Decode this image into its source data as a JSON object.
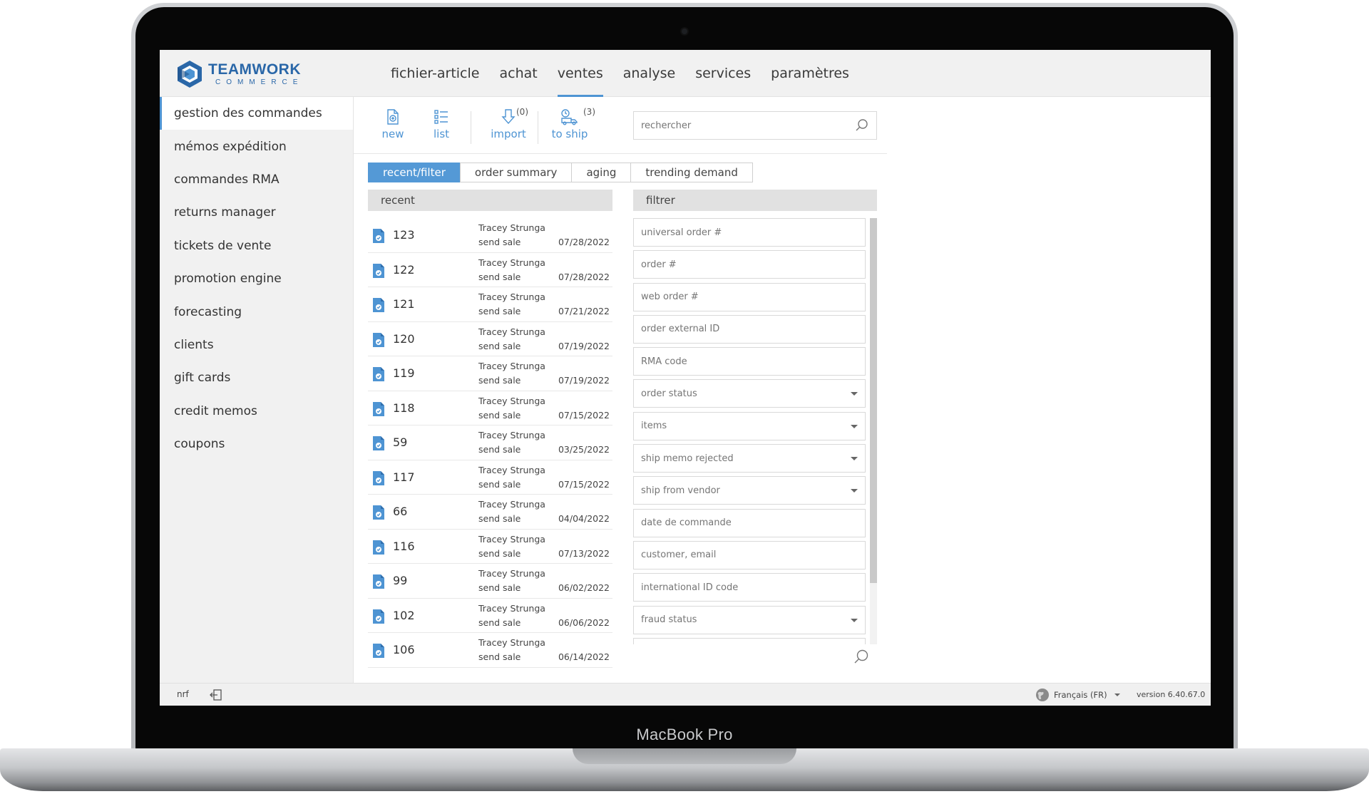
{
  "device": {
    "label": "MacBook Pro"
  },
  "brand": {
    "name": "TEAMWORK",
    "sub": "COMMERCE",
    "color": "#2a67a8"
  },
  "accent": "#4e94d3",
  "top_nav": [
    {
      "label": "fichier-article",
      "active": false
    },
    {
      "label": "achat",
      "active": false
    },
    {
      "label": "ventes",
      "active": true
    },
    {
      "label": "analyse",
      "active": false
    },
    {
      "label": "services",
      "active": false
    },
    {
      "label": "paramètres",
      "active": false
    }
  ],
  "sidebar": {
    "items": [
      {
        "label": "gestion des commandes",
        "active": true
      },
      {
        "label": "mémos expédition"
      },
      {
        "label": "commandes RMA"
      },
      {
        "label": "returns manager"
      },
      {
        "label": "tickets de vente"
      },
      {
        "label": "promotion engine"
      },
      {
        "label": "forecasting"
      },
      {
        "label": "clients"
      },
      {
        "label": "gift cards"
      },
      {
        "label": "credit memos"
      },
      {
        "label": "coupons"
      }
    ]
  },
  "toolbar": {
    "new_label": "new",
    "list_label": "list",
    "import_label": "import",
    "import_count": "(0)",
    "ship_label": "to ship",
    "ship_count": "(3)"
  },
  "search": {
    "placeholder": "rechercher"
  },
  "tabs": [
    {
      "label": "recent/filter",
      "active": true
    },
    {
      "label": "order summary"
    },
    {
      "label": "aging"
    },
    {
      "label": "trending demand"
    }
  ],
  "recent": {
    "header": "recent",
    "rows": [
      {
        "order": "123",
        "customer": "Tracey Strunga",
        "action": "send sale",
        "date": "07/28/2022"
      },
      {
        "order": "122",
        "customer": "Tracey Strunga",
        "action": "send sale",
        "date": "07/28/2022"
      },
      {
        "order": "121",
        "customer": "Tracey Strunga",
        "action": "send sale",
        "date": "07/21/2022"
      },
      {
        "order": "120",
        "customer": "Tracey Strunga",
        "action": "send sale",
        "date": "07/19/2022"
      },
      {
        "order": "119",
        "customer": "Tracey Strunga",
        "action": "send sale",
        "date": "07/19/2022"
      },
      {
        "order": "118",
        "customer": "Tracey Strunga",
        "action": "send sale",
        "date": "07/15/2022"
      },
      {
        "order": "59",
        "customer": "Tracey Strunga",
        "action": "send sale",
        "date": "03/25/2022"
      },
      {
        "order": "117",
        "customer": "Tracey Strunga",
        "action": "send sale",
        "date": "07/15/2022"
      },
      {
        "order": "66",
        "customer": "Tracey Strunga",
        "action": "send sale",
        "date": "04/04/2022"
      },
      {
        "order": "116",
        "customer": "Tracey Strunga",
        "action": "send sale",
        "date": "07/13/2022"
      },
      {
        "order": "99",
        "customer": "Tracey Strunga",
        "action": "send sale",
        "date": "06/02/2022"
      },
      {
        "order": "102",
        "customer": "Tracey Strunga",
        "action": "send sale",
        "date": "06/06/2022"
      },
      {
        "order": "106",
        "customer": "Tracey Strunga",
        "action": "send sale",
        "date": "06/14/2022"
      }
    ]
  },
  "filter": {
    "header": "filtrer",
    "fields": [
      {
        "placeholder": "universal order #",
        "type": "text"
      },
      {
        "placeholder": "order #",
        "type": "text"
      },
      {
        "placeholder": "web order #",
        "type": "text"
      },
      {
        "placeholder": "order external ID",
        "type": "text"
      },
      {
        "placeholder": "RMA code",
        "type": "text"
      },
      {
        "placeholder": "order status",
        "type": "select"
      },
      {
        "placeholder": "items",
        "type": "select"
      },
      {
        "placeholder": "ship memo rejected",
        "type": "select"
      },
      {
        "placeholder": "ship from vendor",
        "type": "select"
      },
      {
        "placeholder": "date de commande",
        "type": "text"
      },
      {
        "placeholder": "customer, email",
        "type": "text"
      },
      {
        "placeholder": "international ID code",
        "type": "text"
      },
      {
        "placeholder": "fraud status",
        "type": "select"
      },
      {
        "placeholder": "",
        "type": "text"
      }
    ]
  },
  "status": {
    "user": "nrf",
    "language": "Français (FR)",
    "version": "version 6.40.67.0"
  }
}
